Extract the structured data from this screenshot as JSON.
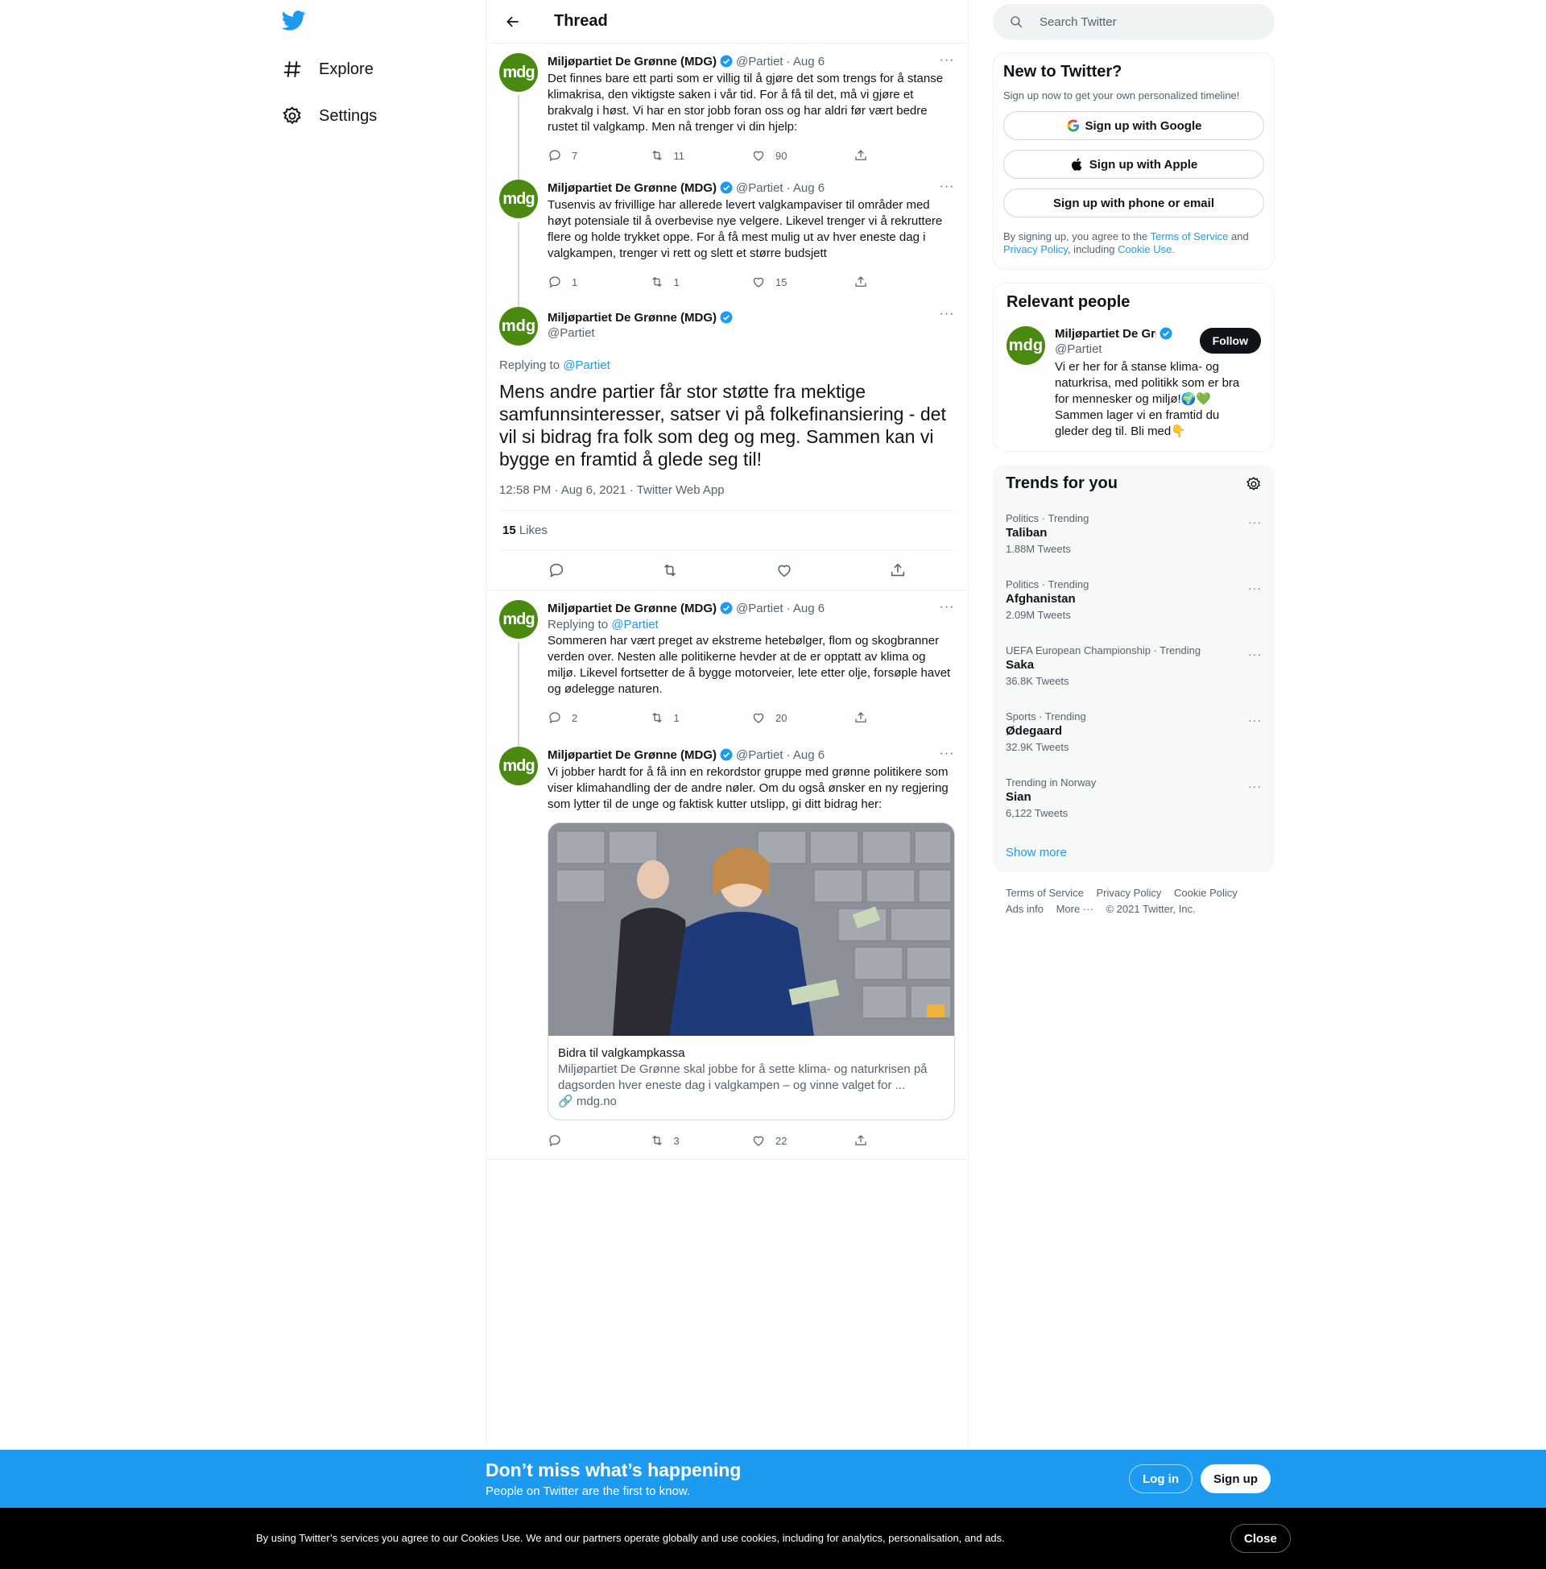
{
  "nav": {
    "explore": "Explore",
    "settings": "Settings"
  },
  "header": {
    "title": "Thread"
  },
  "author": {
    "name": "Miljøpartiet De Grønne (MDG)",
    "handle": "@Partiet",
    "avatar_text": "mdg",
    "avatar_color": "#4a8a10"
  },
  "tweets": [
    {
      "date": "· Aug 6",
      "text": "Det finnes bare ett parti som er villig til å gjøre det som trengs for å stanse klimakrisa, den viktigste saken i vår tid. For å få til det, må vi gjøre et brakvalg i høst. Vi har en stor jobb foran oss og har aldri før vært bedre rustet til valgkamp. Men nå trenger vi din hjelp:",
      "replies": "7",
      "retweets": "11",
      "likes": "90"
    },
    {
      "date": "· Aug 6",
      "text": "Tusenvis av frivillige har allerede levert valgkampaviser til områder med høyt potensiale til å overbevise nye velgere. Likevel trenger vi å rekruttere flere og holde trykket oppe. For å få mest mulig ut av hver eneste dag i valgkampen, trenger vi rett og slett et større budsjett",
      "replies": "1",
      "retweets": "1",
      "likes": "15"
    }
  ],
  "focus": {
    "replying_prefix": "Replying to ",
    "replying_to": "@Partiet",
    "text": "Mens andre partier får stor støtte fra mektige samfunnsinteresser, satser vi på folkefinansiering - det vil si bidrag fra folk som deg og meg. Sammen kan vi bygge en framtid å glede seg til!",
    "meta": "12:58 PM · Aug 6, 2021 · Twitter Web App",
    "likes_count": "15",
    "likes_label": " Likes"
  },
  "replies": [
    {
      "date": "· Aug 6",
      "replying_prefix": "Replying to ",
      "replying_to": "@Partiet",
      "text": "Sommeren har vært preget av ekstreme hetebølger, flom og skogbranner verden over. Nesten alle politikerne hevder at de er opptatt av klima og miljø. Likevel fortsetter de å bygge motorveier, lete etter olje, forsøple havet og ødelegge naturen.",
      "replies": "2",
      "retweets": "1",
      "likes": "20"
    },
    {
      "date": "· Aug 6",
      "text": "Vi jobber hardt for å få inn en rekordstor gruppe med grønne politikere som viser klimahandling der de andre nøler. Om du også ønsker en ny regjering som lytter til de unge og faktisk kutter utslipp, gi ditt bidrag her:",
      "replies": "",
      "retweets": "3",
      "likes": "22",
      "card": {
        "title": "Bidra til valgkampkassa",
        "description": "Miljøpartiet De Grønne skal jobbe for å sette klima- og naturkrisen på dagsorden hver eneste dag i valgkampen – og vinne valget for ...",
        "domain": "mdg.no"
      }
    }
  ],
  "sidebar": {
    "search_placeholder": "Search Twitter",
    "newto": {
      "title": "New to Twitter?",
      "subtitle": "Sign up now to get your own personalized timeline!",
      "google": "Sign up with Google",
      "apple": "Sign up with Apple",
      "phone": "Sign up with phone or email",
      "terms_1": "By signing up, you agree to the ",
      "terms_tos": "Terms of Service",
      "terms_2": " and ",
      "terms_privacy": "Privacy Policy",
      "terms_3": ", including ",
      "terms_cookie": "Cookie Use",
      "terms_4": "."
    },
    "people": {
      "title": "Relevant people",
      "name": "Miljøpartiet De Grønne (MDG)",
      "handle": "@Partiet",
      "bio": "Vi er her for å stanse klima- og naturkrisa, med politikk som er bra for mennesker og miljø!🌍💚 Sammen lager vi en framtid du gleder deg til. Bli med👇",
      "follow": "Follow"
    },
    "trends": {
      "title": "Trends for you",
      "items": [
        {
          "category": "Politics · Trending",
          "name": "Taliban",
          "count": "1.88M Tweets"
        },
        {
          "category": "Politics · Trending",
          "name": "Afghanistan",
          "count": "2.09M Tweets"
        },
        {
          "category": "UEFA European Championship · Trending",
          "name": "Saka",
          "count": "36.8K Tweets"
        },
        {
          "category": "Sports · Trending",
          "name": "Ødegaard",
          "count": "32.9K Tweets"
        },
        {
          "category": "Trending in Norway",
          "name": "Sian",
          "count": "6,122 Tweets"
        }
      ],
      "show_more": "Show more"
    },
    "footer": {
      "tos": "Terms of Service",
      "privacy": "Privacy Policy",
      "cookie": "Cookie Policy",
      "ads": "Ads info",
      "more": "More ···",
      "copyright": "© 2021 Twitter, Inc."
    }
  },
  "banner": {
    "title": "Don’t miss what’s happening",
    "subtitle": "People on Twitter are the first to know.",
    "login": "Log in",
    "signup": "Sign up"
  },
  "cookie": {
    "text": "By using Twitter’s services you agree to our Cookies Use. We and our partners operate globally and use cookies, including for analytics, personalisation, and ads.",
    "close": "Close"
  },
  "colors": {
    "accent": "#1d9bf0",
    "text": "#0f1419",
    "muted": "#536471"
  }
}
